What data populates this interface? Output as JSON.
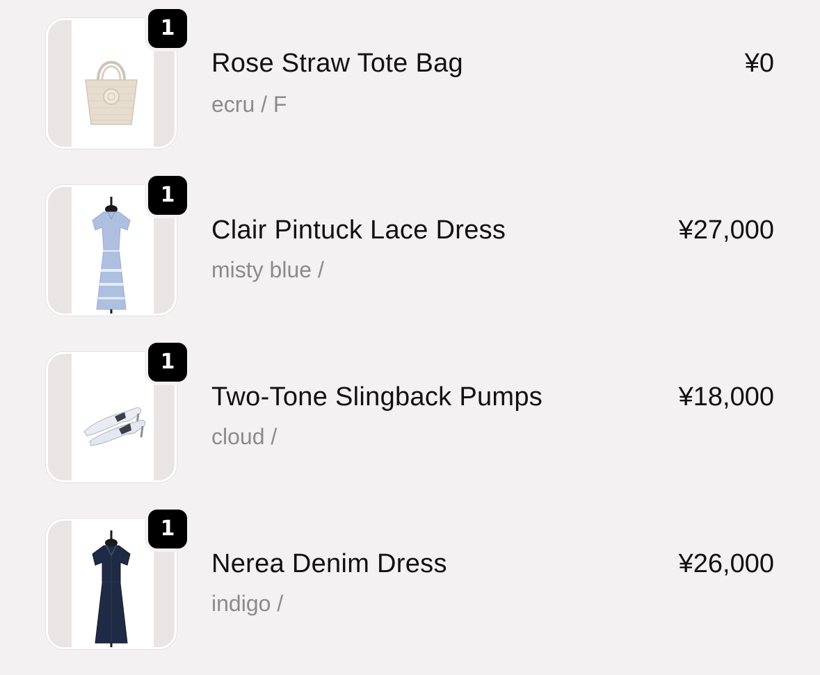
{
  "cart": {
    "items": [
      {
        "quantity": "1",
        "name": "Rose Straw Tote Bag",
        "variant": "ecru / F",
        "price": "¥0",
        "image": "straw-tote-bag-image"
      },
      {
        "quantity": "1",
        "name": "Clair Pintuck Lace Dress",
        "variant": "misty blue /",
        "price": "¥27,000",
        "image": "lace-dress-image"
      },
      {
        "quantity": "1",
        "name": "Two-Tone Slingback Pumps",
        "variant": "cloud /",
        "price": "¥18,000",
        "image": "slingback-pumps-image"
      },
      {
        "quantity": "1",
        "name": "Nerea Denim Dress",
        "variant": "indigo /",
        "price": "¥26,000",
        "image": "denim-dress-image"
      }
    ]
  },
  "colors": {
    "background": "#f3f1f2",
    "badge": "#000000",
    "primary_text": "#111111",
    "secondary_text": "#8b8a8c",
    "misty_blue": "#aebfe0",
    "indigo": "#1f2a44",
    "ecru": "#e6ddd0"
  }
}
